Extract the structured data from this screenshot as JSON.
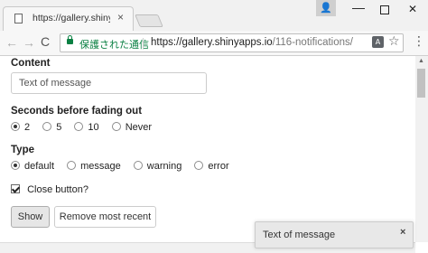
{
  "browser": {
    "tab_title": "https://gallery.shinyapps",
    "tab_close": "×",
    "user_badge": "👤",
    "window_controls": {
      "minimize": "—",
      "close": "✕"
    },
    "nav": {
      "back": "←",
      "forward": "→",
      "reload": "C"
    },
    "address_bar": {
      "security_label": "保護された通信",
      "url_host": "https://gallery.shinyapps.io",
      "url_path": "/116-notifications/"
    },
    "translate_glyph": "A",
    "star_glyph": "☆",
    "menu_glyph": "⋮"
  },
  "form": {
    "content_label": "Content",
    "content_value": "Text of message",
    "seconds_label": "Seconds before fading out",
    "seconds_options": [
      "2",
      "5",
      "10",
      "Never"
    ],
    "seconds_selected": "2",
    "type_label": "Type",
    "type_options": [
      "default",
      "message",
      "warning",
      "error"
    ],
    "type_selected": "default",
    "close_button_label": "Close button?",
    "close_button_checked": true,
    "show_button": "Show",
    "remove_button": "Remove most recent"
  },
  "notification": {
    "text": "Text of message",
    "close": "×"
  },
  "colors": {
    "secure_green": "#0b8043",
    "notification_bg": "#e8e8e8"
  }
}
